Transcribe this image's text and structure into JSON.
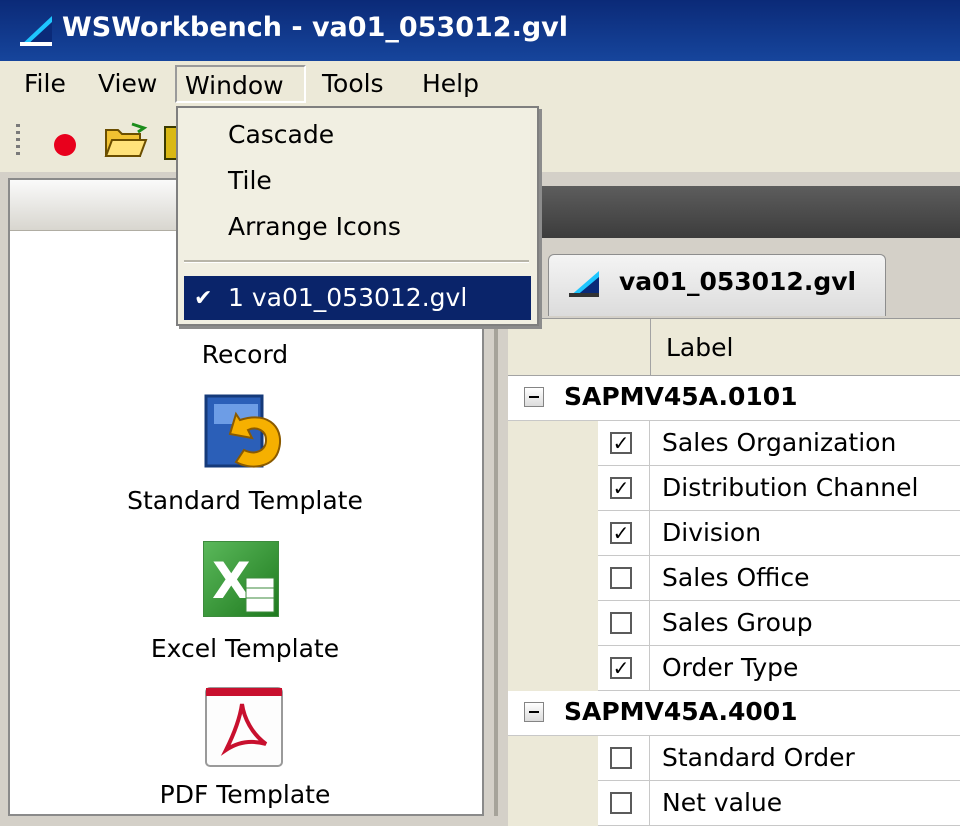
{
  "window": {
    "title": "WSWorkbench - va01_053012.gvl"
  },
  "menubar": {
    "items": [
      "File",
      "View",
      "Window",
      "Tools",
      "Help"
    ]
  },
  "window_menu": {
    "items": [
      "Cascade",
      "Tile",
      "Arrange Icons"
    ],
    "selected": "1 va01_053012.gvl"
  },
  "left_panel": {
    "items": [
      "Record",
      "Standard Template",
      "Excel Template",
      "PDF Template"
    ]
  },
  "document": {
    "tab_label": "va01_053012.gvl",
    "column_header": "Label",
    "groups": [
      {
        "name": "SAPMV45A.0101",
        "fields": [
          {
            "label": "Sales Organization",
            "checked": true
          },
          {
            "label": "Distribution Channel",
            "checked": true
          },
          {
            "label": "Division",
            "checked": true
          },
          {
            "label": "Sales Office",
            "checked": false
          },
          {
            "label": "Sales Group",
            "checked": false
          },
          {
            "label": "Order Type",
            "checked": true
          }
        ]
      },
      {
        "name": "SAPMV45A.4001",
        "fields": [
          {
            "label": "Standard Order",
            "checked": false
          },
          {
            "label": "Net value",
            "checked": false
          }
        ]
      }
    ]
  },
  "colors": {
    "title_bar": "#0b2a78",
    "menu_highlight": "#0a246a",
    "record_dot": "#e8001c"
  }
}
